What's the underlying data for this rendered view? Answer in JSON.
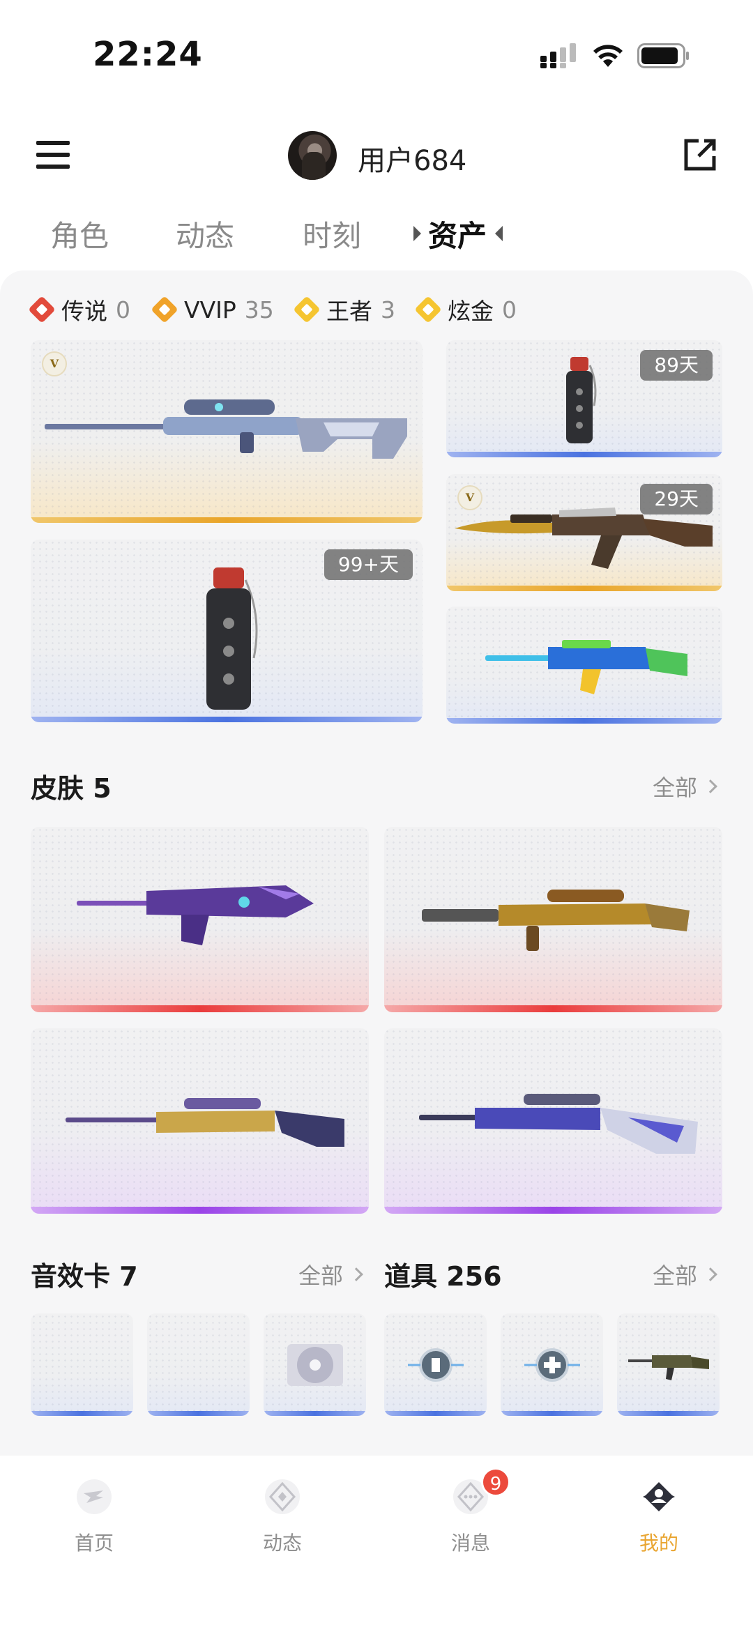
{
  "status_bar": {
    "time": "22:24"
  },
  "header": {
    "username": "用户684"
  },
  "tabs": [
    {
      "label": "角色"
    },
    {
      "label": "动态"
    },
    {
      "label": "时刻"
    },
    {
      "label": "资产"
    }
  ],
  "legend": [
    {
      "name": "传说",
      "count": "0",
      "color": "#e24a3b"
    },
    {
      "name": "VVIP",
      "count": "35",
      "color": "#f0a32a"
    },
    {
      "name": "王者",
      "count": "3",
      "color": "#f5c531"
    },
    {
      "name": "炫金",
      "count": "0",
      "color": "#f5c531"
    }
  ],
  "featured": {
    "cards": [
      {
        "rarity": "gold",
        "vip": true,
        "icon": "sniper-rifle-art"
      },
      {
        "rarity": "blue",
        "days": "89天",
        "icon": "grenade-art"
      },
      {
        "rarity": "gold",
        "vip": true,
        "days": "29天",
        "icon": "ak-rifle-art"
      },
      {
        "rarity": "blue",
        "days": "99+天",
        "icon": "grenade-art"
      },
      {
        "rarity": "blue",
        "icon": "assault-rifle-art"
      }
    ]
  },
  "skins": {
    "title": "皮肤 5",
    "all_label": "全部"
  },
  "sound_cards": {
    "title": "音效卡 7",
    "all_label": "全部"
  },
  "props": {
    "title": "道具 256",
    "all_label": "全部"
  },
  "nav": [
    {
      "label": "首页",
      "icon": "home-icon"
    },
    {
      "label": "动态",
      "icon": "feed-icon"
    },
    {
      "label": "消息",
      "icon": "message-icon",
      "badge": "9"
    },
    {
      "label": "我的",
      "icon": "profile-icon",
      "active": true
    }
  ],
  "colors": {
    "accent": "#e9a531",
    "badge": "#ec4a3c"
  }
}
